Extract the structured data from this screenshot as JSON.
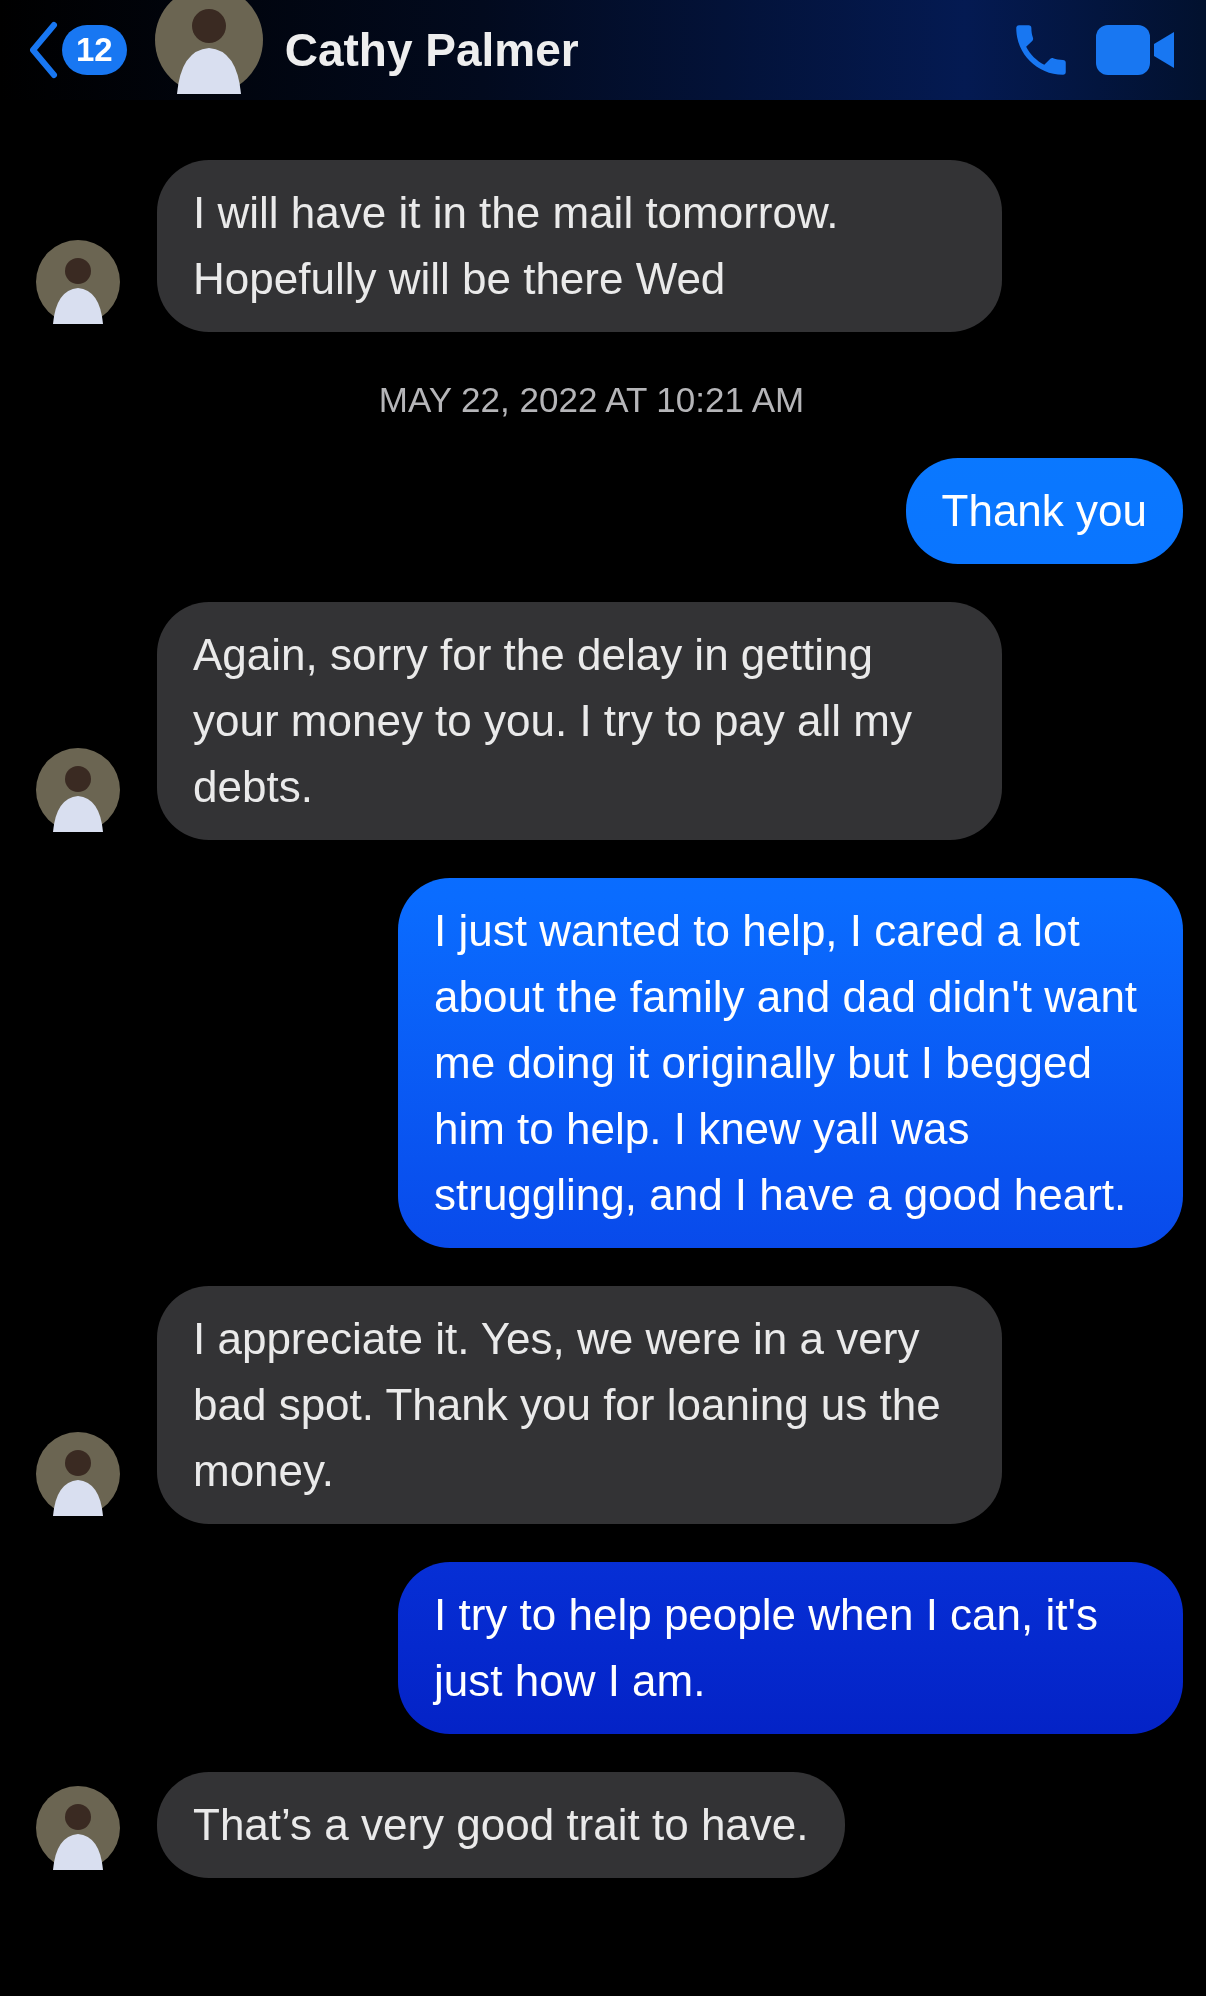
{
  "header": {
    "back_count": "12",
    "contact_name": "Cathy Palmer"
  },
  "messages": [
    {
      "kind": "incoming",
      "text": "I will have it in the mail tomorrow. Hopefully will be there Wed"
    },
    {
      "kind": "timestamp",
      "text": "MAY 22, 2022 AT 10:21 AM"
    },
    {
      "kind": "outgoing",
      "text": "Thank you"
    },
    {
      "kind": "incoming",
      "text": "Again, sorry for the delay in getting your money to you. I try to pay all my debts."
    },
    {
      "kind": "outgoing",
      "text": "I just wanted to help, I cared a lot about the family and dad didn't want me doing it originally but I begged him to help. I knew yall was struggling, and I have a good heart."
    },
    {
      "kind": "incoming",
      "text": "I appreciate it.  Yes, we were in a very bad spot. Thank you for loaning us the money."
    },
    {
      "kind": "outgoing",
      "text": "I try to help people when I can, it's just how I am."
    },
    {
      "kind": "incoming",
      "text": "That’s a very good trait to have."
    }
  ]
}
